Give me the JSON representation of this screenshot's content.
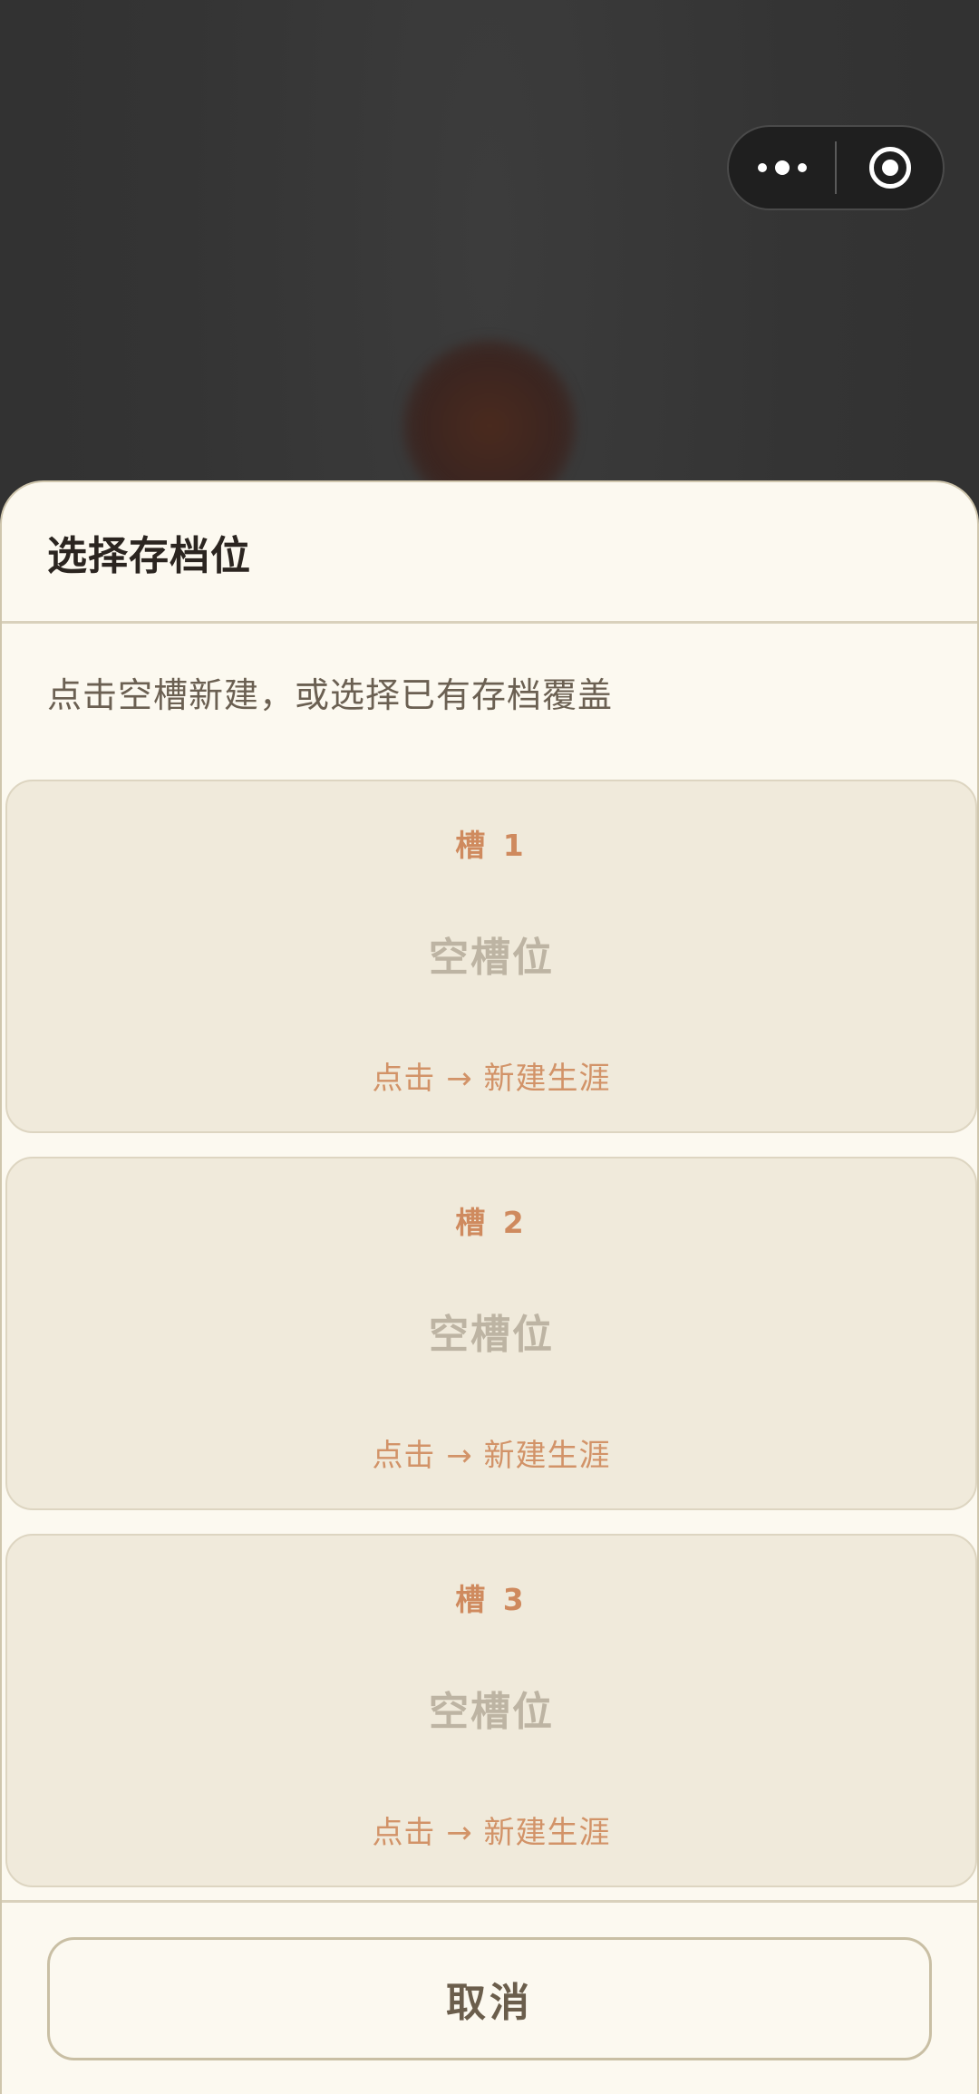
{
  "capsule": {
    "more_icon": "more-dots-icon",
    "close_icon": "target-close-icon"
  },
  "sheet": {
    "title": "选择存档位",
    "hint": "点击空槽新建，或选择已有存档覆盖",
    "slots": [
      {
        "name": "槽 1",
        "status": "空槽位",
        "action": "点击 → 新建生涯"
      },
      {
        "name": "槽 2",
        "status": "空槽位",
        "action": "点击 → 新建生涯"
      },
      {
        "name": "槽 3",
        "status": "空槽位",
        "action": "点击 → 新建生涯"
      }
    ],
    "cancel_label": "取消"
  },
  "colors": {
    "sheet_bg": "#fcf9f0",
    "slot_bg": "#f0eadb",
    "accent": "#cf8a5e",
    "muted": "#bdb4a3"
  }
}
